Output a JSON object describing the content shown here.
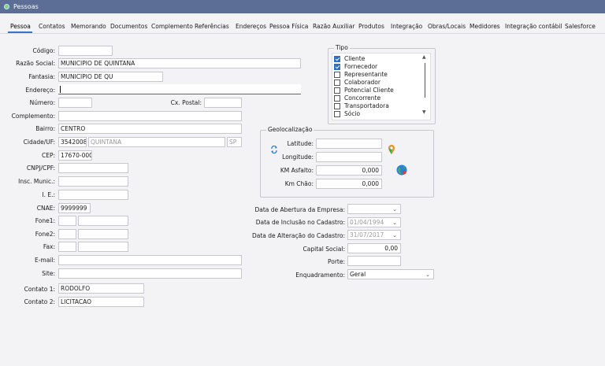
{
  "window": {
    "title": "Pessoas"
  },
  "tabs": [
    "Pessoa",
    "Contatos",
    "Memorando",
    "Documentos",
    "Complemento",
    "Referências",
    "Endereços",
    "Pessoa Física",
    "Razão Auxiliar",
    "Produtos",
    "Integração",
    "Obras/Locais",
    "Medidores",
    "Integração contábil",
    "Salesforce"
  ],
  "form": {
    "codigo": {
      "label": "Código:",
      "value": ""
    },
    "razao_social": {
      "label": "Razão Social:",
      "value": "MUNICIPIO DE QUINTANA"
    },
    "fantasia": {
      "label": "Fantasia:",
      "value": "MUNICIPIO DE QU"
    },
    "endereco": {
      "label": "Endereço:",
      "value": ""
    },
    "numero": {
      "label": "Número:",
      "value": ""
    },
    "cx_postal": {
      "label": "Cx. Postal:",
      "value": ""
    },
    "complemento": {
      "label": "Complemento:",
      "value": ""
    },
    "bairro": {
      "label": "Bairro:",
      "value": "CENTRO"
    },
    "cidade_uf": {
      "label": "Cidade/UF:",
      "code": "3542008",
      "city": "QUINTANA",
      "uf": "SP"
    },
    "cep": {
      "label": "CEP:",
      "value": "17670-000"
    },
    "cnpj_cpf": {
      "label": "CNPJ/CPF:",
      "value": ""
    },
    "insc_munic": {
      "label": "Insc. Munic.:",
      "value": ""
    },
    "ie": {
      "label": "I. E.:",
      "value": ""
    },
    "cnae": {
      "label": "CNAE:",
      "value": "9999999"
    },
    "fone1": {
      "label": "Fone1:",
      "ddd": "",
      "value": ""
    },
    "fone2": {
      "label": "Fone2:",
      "ddd": "",
      "value": ""
    },
    "fax": {
      "label": "Fax:",
      "ddd": "",
      "value": ""
    },
    "email": {
      "label": "E-mail:",
      "value": ""
    },
    "site": {
      "label": "Site:",
      "value": ""
    },
    "contato1": {
      "label": "Contato 1:",
      "value": "RODOLFO"
    },
    "contato2": {
      "label": "Contato 2:",
      "value": "LICITACAO"
    }
  },
  "tipo": {
    "legend": "Tipo",
    "items": [
      {
        "label": "Cliente",
        "checked": true
      },
      {
        "label": "Fornecedor",
        "checked": true
      },
      {
        "label": "Representante",
        "checked": false
      },
      {
        "label": "Colaborador",
        "checked": false
      },
      {
        "label": "Potencial Cliente",
        "checked": false
      },
      {
        "label": "Concorrente",
        "checked": false
      },
      {
        "label": "Transportadora",
        "checked": false
      },
      {
        "label": "Sócio",
        "checked": false
      }
    ]
  },
  "geo": {
    "legend": "Geolocalização",
    "latitude": {
      "label": "Latitude:",
      "value": ""
    },
    "longitude": {
      "label": "Longitude:",
      "value": ""
    },
    "km_asfalto": {
      "label": "KM Asfalto:",
      "value": "0,000"
    },
    "km_chao": {
      "label": "Km Chão:",
      "value": "0,000"
    },
    "icons": [
      "refresh-icon",
      "map-pin-icon",
      "globe-icon"
    ]
  },
  "datas": {
    "abertura": {
      "label": "Data de Abertura da Empresa:",
      "value": ""
    },
    "inclusao": {
      "label": "Data de Inclusão no Cadastro:",
      "value": "01/04/1994"
    },
    "alteracao": {
      "label": "Data de Alteração do Cadastro:",
      "value": "31/07/2017"
    },
    "capital_social": {
      "label": "Capital Social:",
      "value": "0,00"
    },
    "porte": {
      "label": "Porte:",
      "value": ""
    },
    "enquadramento": {
      "label": "Enquadramento:",
      "value": "Geral"
    }
  },
  "colors": {
    "titlebar": "#5c6e96",
    "accent": "#2f6ec5",
    "map_pin": "#e5932a",
    "globe": "#2a7fd6"
  }
}
